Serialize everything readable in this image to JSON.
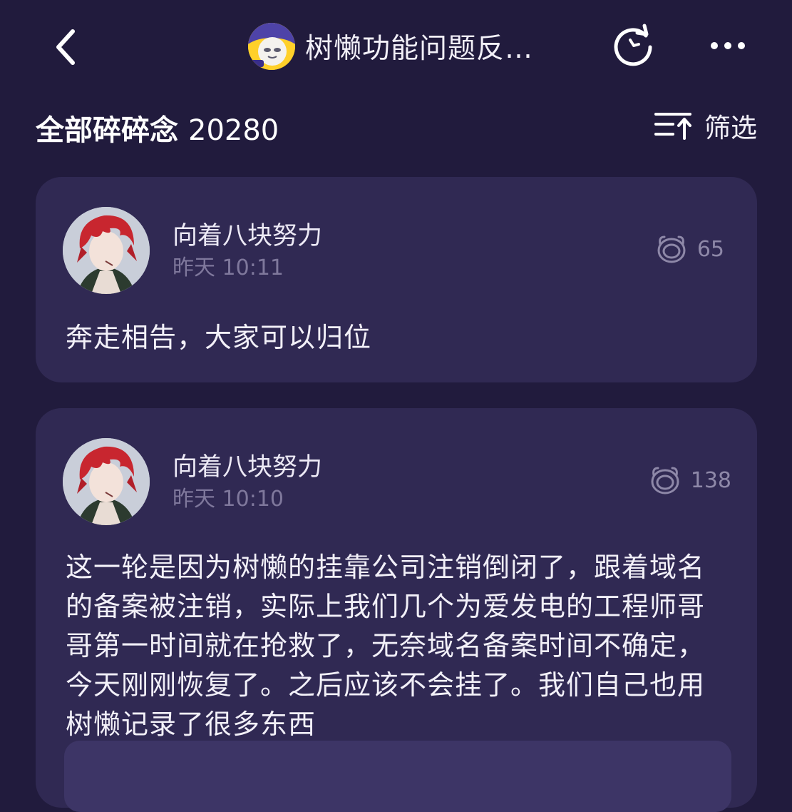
{
  "topbar": {
    "title": "树懒功能问题反…",
    "back_icon": "chevron-left-icon",
    "refresh_icon": "refresh-icon",
    "more_icon": "more-horizontal-icon"
  },
  "header": {
    "label": "全部碎碎念",
    "count": "20280",
    "filter_label": "筛选",
    "filter_icon": "sort-icon"
  },
  "posts": [
    {
      "author": "向着八块努力",
      "time": "昨天 10:11",
      "views": "65",
      "content": "奔走相告，大家可以归位"
    },
    {
      "author": "向着八块努力",
      "time": "昨天 10:10",
      "views": "138",
      "content": "这一轮是因为树懒的挂靠公司注销倒闭了，跟着域名的备案被注销，实际上我们几个为爱发电的工程师哥哥第一时间就在抢救了，无奈域名备案时间不确定，今天刚刚恢复了。之后应该不会挂了。我们自己也用树懒记录了很多东西"
    }
  ],
  "colors": {
    "background": "#211b3d",
    "card": "#302953",
    "logo": "#ffd02a",
    "muted": "#7f789c"
  }
}
